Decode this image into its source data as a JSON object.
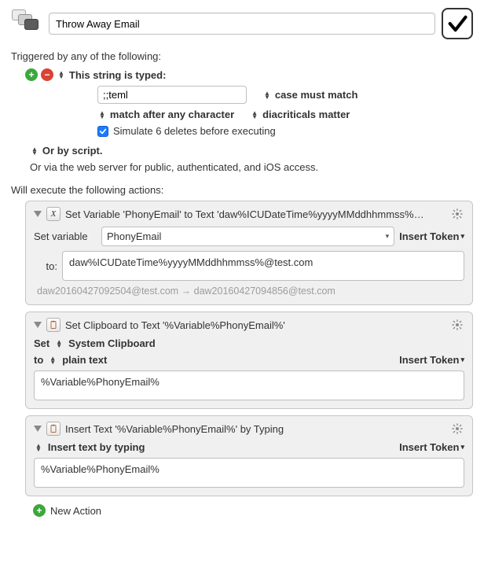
{
  "header": {
    "macro_name": "Throw Away Email"
  },
  "trigger_section": {
    "label": "Triggered by any of the following:",
    "typed_trigger_label": "This string is typed:",
    "typed_value": ";;teml",
    "opt_case": "case must match",
    "opt_match_after": "match after any character",
    "opt_diacriticals": "diacriticals matter",
    "simulate_deletes": "Simulate 6 deletes before executing",
    "script_label": "Or by script.",
    "via_web": "Or via the web server for public, authenticated, and iOS access."
  },
  "actions_section": {
    "label": "Will execute the following actions:",
    "insert_token": "Insert Token",
    "actions": [
      {
        "title": "Set Variable 'PhonyEmail' to Text 'daw%ICUDateTime%yyyyMMddhhmmss%…",
        "set_var_label": "Set variable",
        "var_name": "PhonyEmail",
        "to_label": "to:",
        "to_value": "daw%ICUDateTime%yyyyMMddhhmmss%@test.com",
        "result": "daw20160427092504@test.com → daw20160427094856@test.com"
      },
      {
        "title": "Set Clipboard to Text '%Variable%PhonyEmail%'",
        "set_label": "Set",
        "clipboard_target": "System Clipboard",
        "to_label": "to",
        "format": "plain text",
        "body": "%Variable%PhonyEmail%"
      },
      {
        "title": "Insert Text '%Variable%PhonyEmail%' by Typing",
        "mode_label": "Insert text by typing",
        "body": "%Variable%PhonyEmail%"
      }
    ],
    "new_action": "New Action"
  }
}
